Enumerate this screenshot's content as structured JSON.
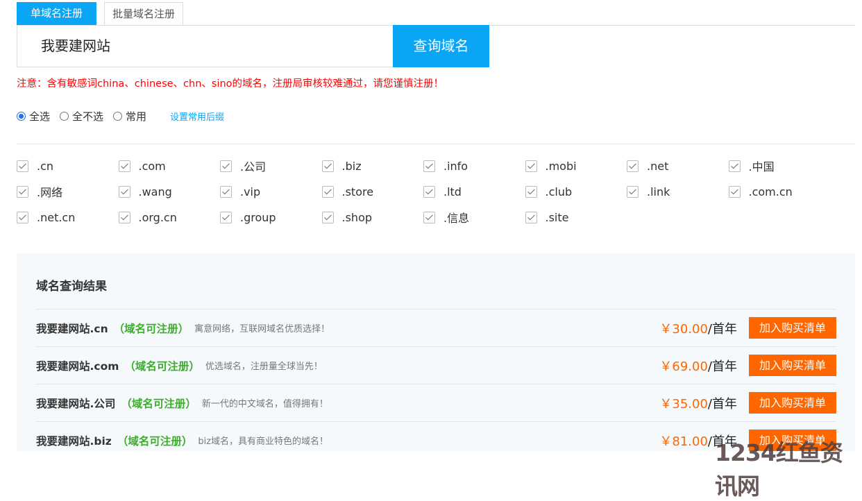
{
  "tabs": [
    {
      "label": "单域名注册",
      "active": true
    },
    {
      "label": "批量域名注册",
      "active": false
    }
  ],
  "search": {
    "value": "我要建网站",
    "button": "查询域名"
  },
  "notice": "注意：含有敏感词china、chinese、chn、sino的域名，注册局审核较难通过，请您谨慎注册！",
  "select": {
    "options": [
      "全选",
      "全不选",
      "常用"
    ],
    "selected": "全选",
    "set_common_link": "设置常用后缀"
  },
  "suffixes": [
    ".cn",
    ".com",
    ".公司",
    ".biz",
    ".info",
    ".mobi",
    ".net",
    ".中国",
    ".网络",
    ".wang",
    ".vip",
    ".store",
    ".ltd",
    ".club",
    ".link",
    ".com.cn",
    ".net.cn",
    ".org.cn",
    ".group",
    ".shop",
    ".信息",
    ".site"
  ],
  "results": {
    "title": "域名查询结果",
    "rows": [
      {
        "domain": "我要建网站.cn",
        "status": "（域名可注册）",
        "desc": "寓意网络，互联网域名优质选择！",
        "price": "￥30.00",
        "unit": "/首年",
        "button": "加入购买清单"
      },
      {
        "domain": "我要建网站.com",
        "status": "（域名可注册）",
        "desc": "优选域名，注册量全球当先！",
        "price": "￥69.00",
        "unit": "/首年",
        "button": "加入购买清单"
      },
      {
        "domain": "我要建网站.公司",
        "status": "（域名可注册）",
        "desc": "新一代的中文域名，值得拥有！",
        "price": "￥35.00",
        "unit": "/首年",
        "button": "加入购买清单"
      },
      {
        "domain": "我要建网站.biz",
        "status": "（域名可注册）",
        "desc": "biz域名，具有商业特色的域名！",
        "price": "￥81.00",
        "unit": "/首年",
        "button": "加入购买清单"
      }
    ]
  },
  "watermark": "1234红鱼资讯网",
  "colors": {
    "primary": "#0aa6f5",
    "accent": "#ff6600",
    "available": "#3cae2b",
    "notice": "#ff0000"
  }
}
